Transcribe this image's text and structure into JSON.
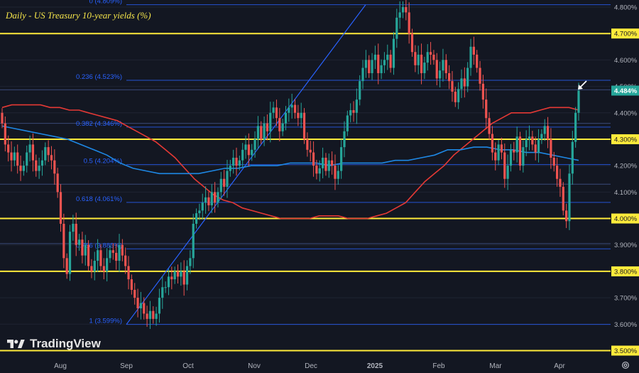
{
  "header": {
    "title": "Daily - US Treasury 10-year yields (%)"
  },
  "branding": {
    "name": "TradingView",
    "logo_icon": "tradingview-logo-icon"
  },
  "controls": {
    "settings_icon": "gear-icon"
  },
  "colors": {
    "background": "#131722",
    "up": "#26a69a",
    "down": "#ef5350",
    "level_line": "#ffeb3b",
    "fib_line": "#2962ff",
    "ma_red": "#e53935",
    "ma_blue": "#1e88e5",
    "trendline": "#2962ff",
    "axis_text": "#b2b5be",
    "current_price_bg": "#26a69a"
  },
  "chart_data": {
    "type": "candlestick",
    "title": "Daily - US Treasury 10-year yields (%)",
    "ylim": [
      3.475,
      4.83
    ],
    "y_ticks": [
      "4.800%",
      "4.700%",
      "4.600%",
      "4.500%",
      "4.400%",
      "4.300%",
      "4.200%",
      "4.100%",
      "4.000%",
      "3.900%",
      "3.800%",
      "3.700%",
      "3.600%",
      "3.500%"
    ],
    "x_ticks": [
      "Aug",
      "Sep",
      "Oct",
      "Nov",
      "Dec",
      "2025",
      "Feb",
      "Mar",
      "Apr"
    ],
    "horizontal_levels": [
      "4.700%",
      "4.300%",
      "4.000%",
      "3.800%",
      "3.500%"
    ],
    "fib_levels": [
      {
        "label": "0 (4.809%)",
        "value": 4.809
      },
      {
        "label": "0.236 (4.523%)",
        "value": 4.523
      },
      {
        "label": "0.382 (4.346%)",
        "value": 4.346
      },
      {
        "label": "0.5 (4.204%)",
        "value": 4.204
      },
      {
        "label": "0.618 (4.061%)",
        "value": 4.061
      },
      {
        "label": "0.786 (3.885%)",
        "value": 3.885
      },
      {
        "label": "1 (3.599%)",
        "value": 3.599
      }
    ],
    "extra_levels": [
      4.487,
      4.36,
      4.13,
      3.905
    ],
    "current_price": "4.484%",
    "series": [
      {
        "type": "candles",
        "closes": [
          4.36,
          4.28,
          4.25,
          4.22,
          4.25,
          4.2,
          4.18,
          4.2,
          4.25,
          4.28,
          4.22,
          4.18,
          4.2,
          4.22,
          4.27,
          4.24,
          4.22,
          4.17,
          4.1,
          3.98,
          3.85,
          3.79,
          3.95,
          3.98,
          3.9,
          3.92,
          3.86,
          3.9,
          3.82,
          3.8,
          3.84,
          3.88,
          3.82,
          3.8,
          3.85,
          3.88,
          3.87,
          3.84,
          3.9,
          3.86,
          3.82,
          3.77,
          3.73,
          3.7,
          3.66,
          3.68,
          3.64,
          3.62,
          3.65,
          3.62,
          3.64,
          3.7,
          3.74,
          3.74,
          3.78,
          3.77,
          3.8,
          3.78,
          3.8,
          3.75,
          3.82,
          3.85,
          3.98,
          4.02,
          4.03,
          4.06,
          4.08,
          4.05,
          4.1,
          4.06,
          4.1,
          4.15,
          4.12,
          4.18,
          4.2,
          4.23,
          4.2,
          4.22,
          4.26,
          4.28,
          4.24,
          4.26,
          4.3,
          4.35,
          4.3,
          4.36,
          4.33,
          4.4,
          4.42,
          4.38,
          4.33,
          4.36,
          4.4,
          4.42,
          4.43,
          4.4,
          4.38,
          4.4,
          4.3,
          4.26,
          4.25,
          4.2,
          4.17,
          4.19,
          4.23,
          4.18,
          4.22,
          4.2,
          4.15,
          4.18,
          4.27,
          4.33,
          4.39,
          4.41,
          4.4,
          4.45,
          4.52,
          4.57,
          4.6,
          4.55,
          4.6,
          4.62,
          4.55,
          4.58,
          4.6,
          4.62,
          4.57,
          4.68,
          4.76,
          4.78,
          4.8,
          4.78,
          4.7,
          4.63,
          4.58,
          4.62,
          4.55,
          4.59,
          4.63,
          4.62,
          4.6,
          4.53,
          4.56,
          4.6,
          4.55,
          4.52,
          4.48,
          4.44,
          4.49,
          4.53,
          4.5,
          4.57,
          4.65,
          4.62,
          4.57,
          4.51,
          4.45,
          4.38,
          4.32,
          4.25,
          4.22,
          4.28,
          4.25,
          4.15,
          4.2,
          4.26,
          4.25,
          4.31,
          4.2,
          4.27,
          4.3,
          4.31,
          4.28,
          4.25,
          4.3,
          4.32,
          4.35,
          4.3,
          4.23,
          4.2,
          4.15,
          4.12,
          4.03,
          3.99,
          4.17,
          4.29,
          4.4,
          4.484
        ]
      },
      {
        "name": "",
        "type": "line",
        "values": [
          4.42,
          4.43,
          4.43,
          4.43,
          4.43,
          4.42,
          4.42,
          4.41,
          4.41,
          4.4,
          4.39,
          4.38,
          4.37,
          4.35,
          4.33,
          4.31,
          4.29,
          4.26,
          4.23,
          4.19,
          4.15,
          4.12,
          4.09,
          4.07,
          4.06,
          4.04,
          4.03,
          4.02,
          4.01,
          4.0,
          4.0,
          4.0,
          4.0,
          4.01,
          4.01,
          4.01,
          4.0,
          4.0,
          4.0,
          4.01,
          4.02,
          4.04,
          4.06,
          4.1,
          4.14,
          4.17,
          4.2,
          4.24,
          4.27,
          4.3,
          4.33,
          4.36,
          4.38,
          4.4,
          4.4,
          4.4,
          4.41,
          4.42,
          4.42,
          4.42,
          4.41
        ]
      },
      {
        "name": "",
        "type": "line",
        "values": [
          4.35,
          4.34,
          4.33,
          4.32,
          4.31,
          4.3,
          4.28,
          4.26,
          4.24,
          4.21,
          4.19,
          4.18,
          4.17,
          4.17,
          4.17,
          4.17,
          4.18,
          4.19,
          4.19,
          4.2,
          4.2,
          4.2,
          4.21,
          4.21,
          4.21,
          4.2,
          4.21,
          4.21,
          4.21,
          4.21,
          4.22,
          4.22,
          4.23,
          4.24,
          4.26,
          4.26,
          4.27,
          4.27,
          4.26,
          4.26,
          4.25,
          4.25,
          4.24,
          4.23,
          4.22
        ]
      }
    ]
  }
}
